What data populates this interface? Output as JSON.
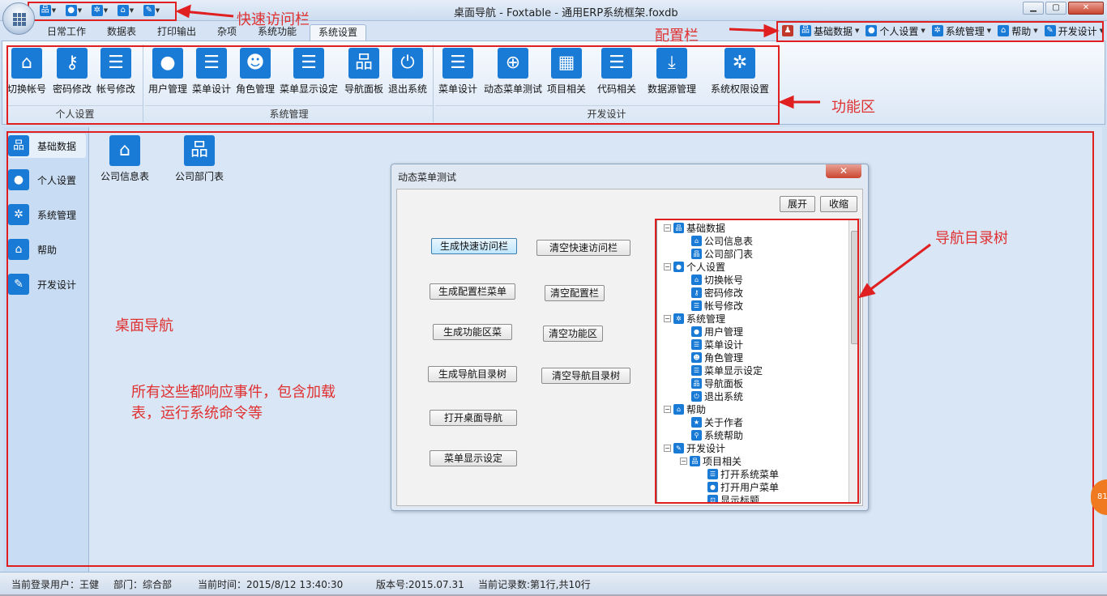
{
  "window": {
    "title": "桌面导航 - Foxtable - 通用ERP系统框架.foxdb",
    "minimize": "▁",
    "maximize": "▢",
    "close": "✕"
  },
  "tabs": [
    {
      "label": "日常工作"
    },
    {
      "label": "数据表"
    },
    {
      "label": "打印输出"
    },
    {
      "label": "杂项"
    },
    {
      "label": "系统功能"
    },
    {
      "label": "系统设置"
    }
  ],
  "configbar": [
    {
      "label": "基础数据"
    },
    {
      "label": "个人设置"
    },
    {
      "label": "系统管理"
    },
    {
      "label": "帮助"
    },
    {
      "label": "开发设计"
    }
  ],
  "ribbon": {
    "groups": [
      {
        "label": "个人设置",
        "buttons": [
          {
            "label": "切换帐号",
            "icon": "home-icon"
          },
          {
            "label": "密码修改",
            "icon": "key-icon"
          },
          {
            "label": "帐号修改",
            "icon": "server-icon"
          }
        ]
      },
      {
        "label": "系统管理",
        "buttons": [
          {
            "label": "用户管理",
            "icon": "user-icon"
          },
          {
            "label": "菜单设计",
            "icon": "list-icon"
          },
          {
            "label": "角色管理",
            "icon": "users-icon"
          },
          {
            "label": "菜单显示设定",
            "icon": "list-icon"
          },
          {
            "label": "导航面板",
            "icon": "sitemap-icon"
          },
          {
            "label": "退出系统",
            "icon": "power-icon"
          }
        ]
      },
      {
        "label": "开发设计",
        "buttons": [
          {
            "label": "菜单设计",
            "icon": "list-icon"
          },
          {
            "label": "动态菜单测试",
            "icon": "zoom-icon"
          },
          {
            "label": "项目相关",
            "icon": "qrcode-icon"
          },
          {
            "label": "代码相关",
            "icon": "list-icon"
          },
          {
            "label": "数据源管理",
            "icon": "download-icon"
          },
          {
            "label": "系统权限设置",
            "icon": "gear-icon"
          }
        ]
      }
    ]
  },
  "annotations": {
    "quick_access": "快速访问栏",
    "config_bar": "配置栏",
    "function_area": "功能区",
    "nav_tree": "导航目录树",
    "desktop_nav": "桌面导航",
    "note_line1": "所有这些都响应事件，包含加载",
    "note_line2": "表，运行系统命令等"
  },
  "leftnav": [
    {
      "label": "基础数据"
    },
    {
      "label": "个人设置"
    },
    {
      "label": "系统管理"
    },
    {
      "label": "帮助"
    },
    {
      "label": "开发设计"
    }
  ],
  "tiles": [
    {
      "label": "公司信息表"
    },
    {
      "label": "公司部门表"
    }
  ],
  "dialog": {
    "title": "动态菜单测试",
    "close": "✕",
    "expand": "展开",
    "collapse": "收缩",
    "buttons": [
      {
        "label": "生成快速访问栏"
      },
      {
        "label": "清空快速访问栏"
      },
      {
        "label": "生成配置栏菜单"
      },
      {
        "label": "清空配置栏"
      },
      {
        "label": "生成功能区菜"
      },
      {
        "label": "清空功能区"
      },
      {
        "label": "生成导航目录树"
      },
      {
        "label": "清空导航目录树"
      },
      {
        "label": "打开桌面导航"
      },
      {
        "label": "菜单显示设定"
      }
    ],
    "tree": [
      {
        "label": "基础数据",
        "level": 0
      },
      {
        "label": "公司信息表",
        "level": 1
      },
      {
        "label": "公司部门表",
        "level": 1
      },
      {
        "label": "个人设置",
        "level": 0
      },
      {
        "label": "切换帐号",
        "level": 1
      },
      {
        "label": "密码修改",
        "level": 1
      },
      {
        "label": "帐号修改",
        "level": 1
      },
      {
        "label": "系统管理",
        "level": 0
      },
      {
        "label": "用户管理",
        "level": 1
      },
      {
        "label": "菜单设计",
        "level": 1
      },
      {
        "label": "角色管理",
        "level": 1
      },
      {
        "label": "菜单显示设定",
        "level": 1
      },
      {
        "label": "导航面板",
        "level": 1
      },
      {
        "label": "退出系统",
        "level": 1
      },
      {
        "label": "帮助",
        "level": 0
      },
      {
        "label": "关于作者",
        "level": 1
      },
      {
        "label": "系统帮助",
        "level": 1
      },
      {
        "label": "开发设计",
        "level": 0
      },
      {
        "label": "项目相关",
        "level": 1
      },
      {
        "label": "打开系统菜单",
        "level": 2
      },
      {
        "label": "打开用户菜单",
        "level": 2
      },
      {
        "label": "显示标题",
        "level": 2
      }
    ]
  },
  "status": {
    "user": "当前登录用户：王健",
    "dept": "部门：综合部",
    "time": "当前时间：2015/8/12 13:40:30",
    "version": "版本号:2015.07.31",
    "record": "当前记录数:第1行,共10行"
  },
  "side_badge": "81"
}
